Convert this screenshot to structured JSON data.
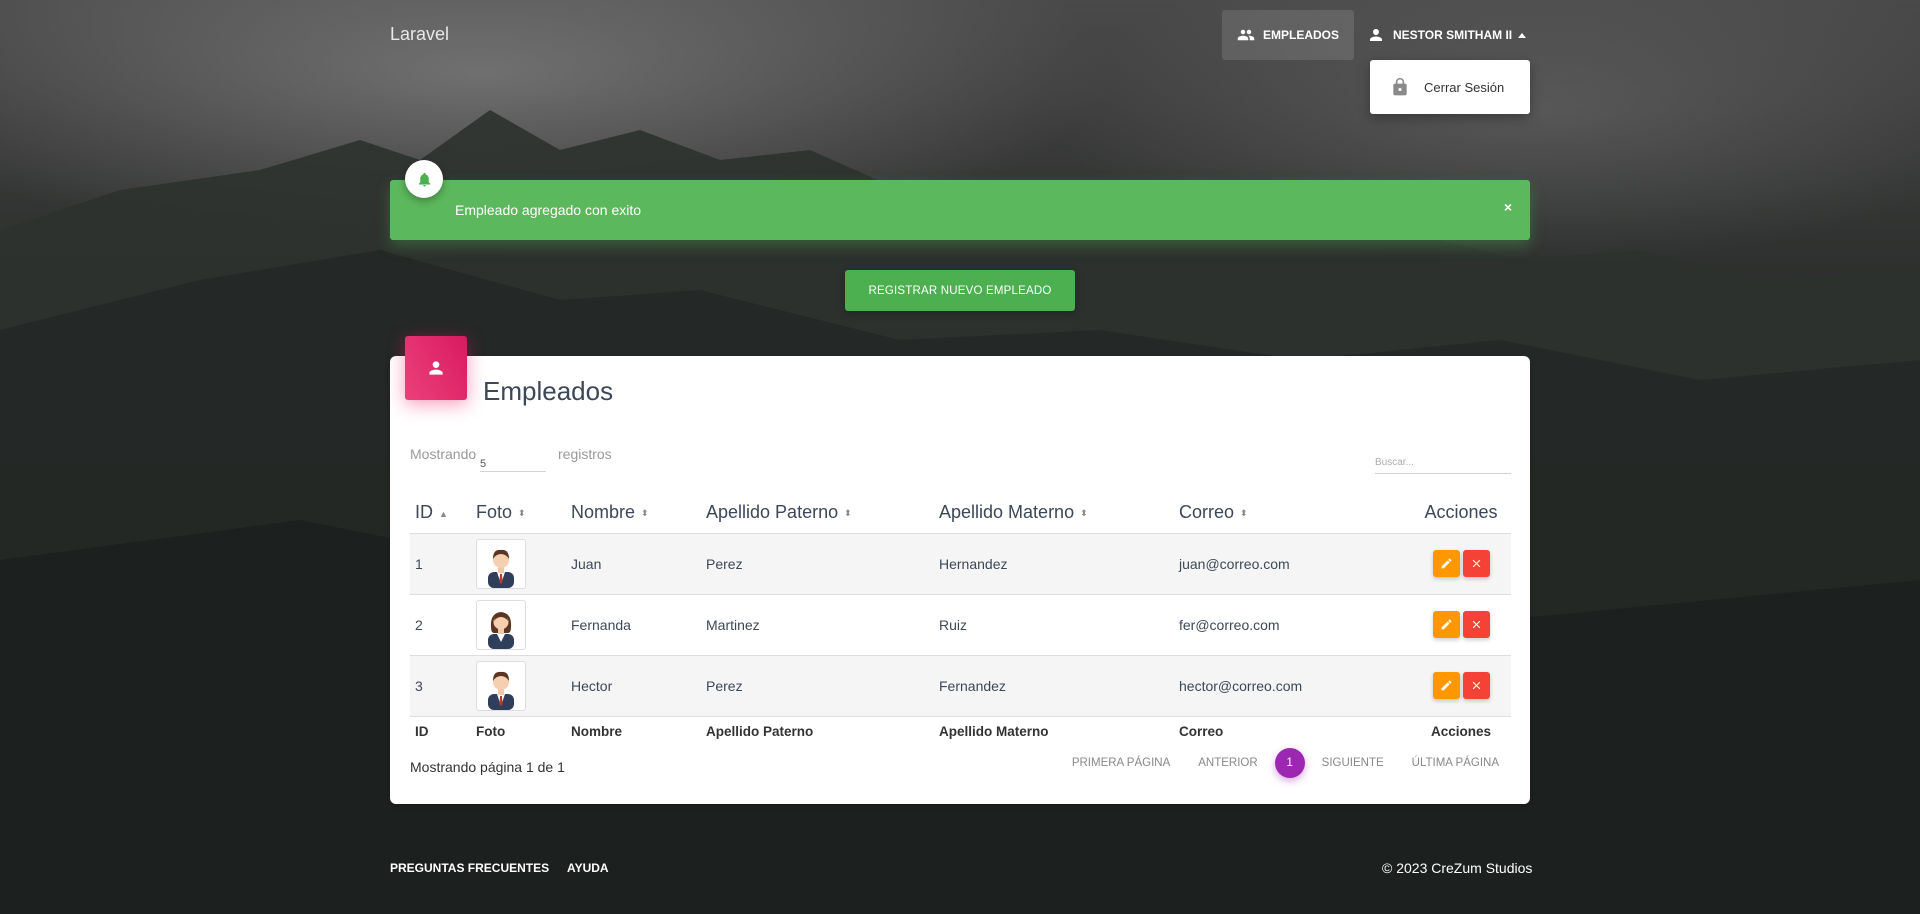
{
  "nav": {
    "brand": "Laravel",
    "employees_label": "Empleados",
    "user_label": "Nestor Smitham II",
    "dropdown": {
      "logout_label": "Cerrar Sesión"
    }
  },
  "alert": {
    "message": "Empleado agregado con exito",
    "close": "×"
  },
  "register_button": "Registrar Nuevo Empleado",
  "card": {
    "title": "Empleados",
    "show_prefix": "Mostrando",
    "show_value": "5",
    "show_suffix": "registros",
    "search_placeholder": "Buscar..."
  },
  "table": {
    "headers": [
      "ID",
      "Foto",
      "Nombre",
      "Apellido Paterno",
      "Apellido Materno",
      "Correo",
      "Acciones"
    ],
    "rows": [
      {
        "id": "1",
        "nombre": "Juan",
        "paterno": "Perez",
        "materno": "Hernandez",
        "correo": "juan@correo.com",
        "avatar": "male"
      },
      {
        "id": "2",
        "nombre": "Fernanda",
        "paterno": "Martinez",
        "materno": "Ruiz",
        "correo": "fer@correo.com",
        "avatar": "female"
      },
      {
        "id": "3",
        "nombre": "Hector",
        "paterno": "Perez",
        "materno": "Fernandez",
        "correo": "hector@correo.com",
        "avatar": "male"
      }
    ]
  },
  "pagination": {
    "info": "Mostrando página 1 de 1",
    "first": "Primera Página",
    "prev": "Anterior",
    "current": "1",
    "next": "Siguiente",
    "last": "Última Página"
  },
  "footer": {
    "faq": "Preguntas Frecuentes",
    "help": "Ayuda",
    "copyright": "© 2023 CreZum Studios"
  },
  "colors": {
    "success": "#4caf50",
    "rose": "#e91e63",
    "purple": "#9c27b0",
    "warning": "#ff9800",
    "danger": "#f44336"
  }
}
